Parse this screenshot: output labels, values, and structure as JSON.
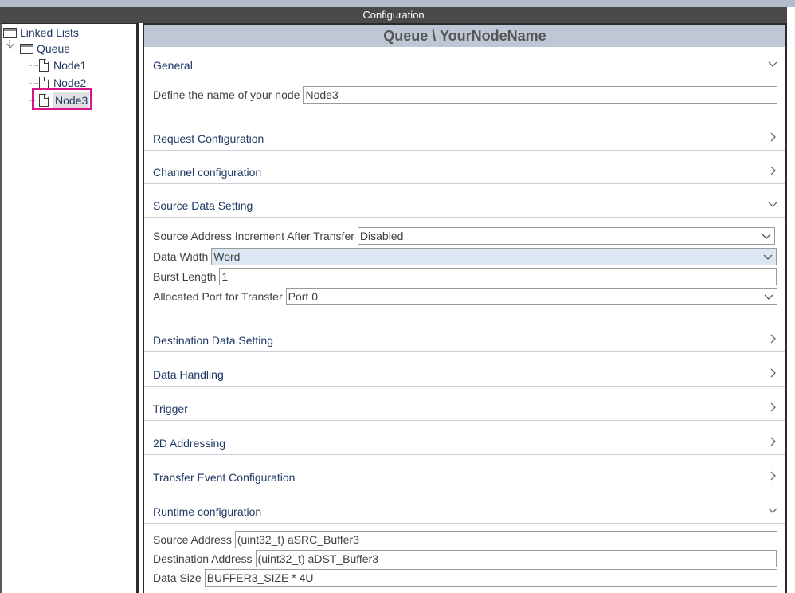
{
  "window": {
    "title": "Configuration"
  },
  "tree": {
    "root": "Linked Lists",
    "queue": "Queue",
    "nodes": [
      "Node1",
      "Node2",
      "Node3"
    ],
    "selected": "Node3"
  },
  "panel": {
    "title": "Queue \\ YourNodeName",
    "sections": {
      "general": "General",
      "request": "Request Configuration",
      "channel": "Channel configuration",
      "source": "Source Data Setting",
      "destination": "Destination Data Setting",
      "handling": "Data Handling",
      "trigger": "Trigger",
      "addressing": "2D Addressing",
      "transfer_event": "Transfer Event Configuration",
      "runtime": "Runtime configuration"
    },
    "fields": {
      "node_name_label": "Define the name of your node",
      "node_name_value": "Node3",
      "src_inc_label": "Source Address Increment After Transfer",
      "src_inc_value": "Disabled",
      "data_width_label": "Data Width",
      "data_width_value": "Word",
      "burst_label": "Burst Length",
      "burst_value": "1",
      "port_label": "Allocated Port for Transfer",
      "port_value": "Port 0",
      "src_addr_label": "Source Address",
      "src_addr_value": "(uint32_t) aSRC_Buffer3",
      "dst_addr_label": "Destination Address",
      "dst_addr_value": "(uint32_t) aDST_Buffer3",
      "size_label": "Data Size",
      "size_value": "BUFFER3_SIZE * 4U"
    }
  },
  "icons": {
    "folder": "folder-icon",
    "document": "document-icon",
    "expanded": "chevron-down-icon",
    "collapsed": "chevron-right-icon"
  },
  "colors": {
    "title_bar": "#4a4a4a",
    "panel_header": "#bdc8d4",
    "label_text": "#1f3864",
    "selection_highlight": "#d8168a",
    "field_highlight": "#dbe8f4"
  }
}
